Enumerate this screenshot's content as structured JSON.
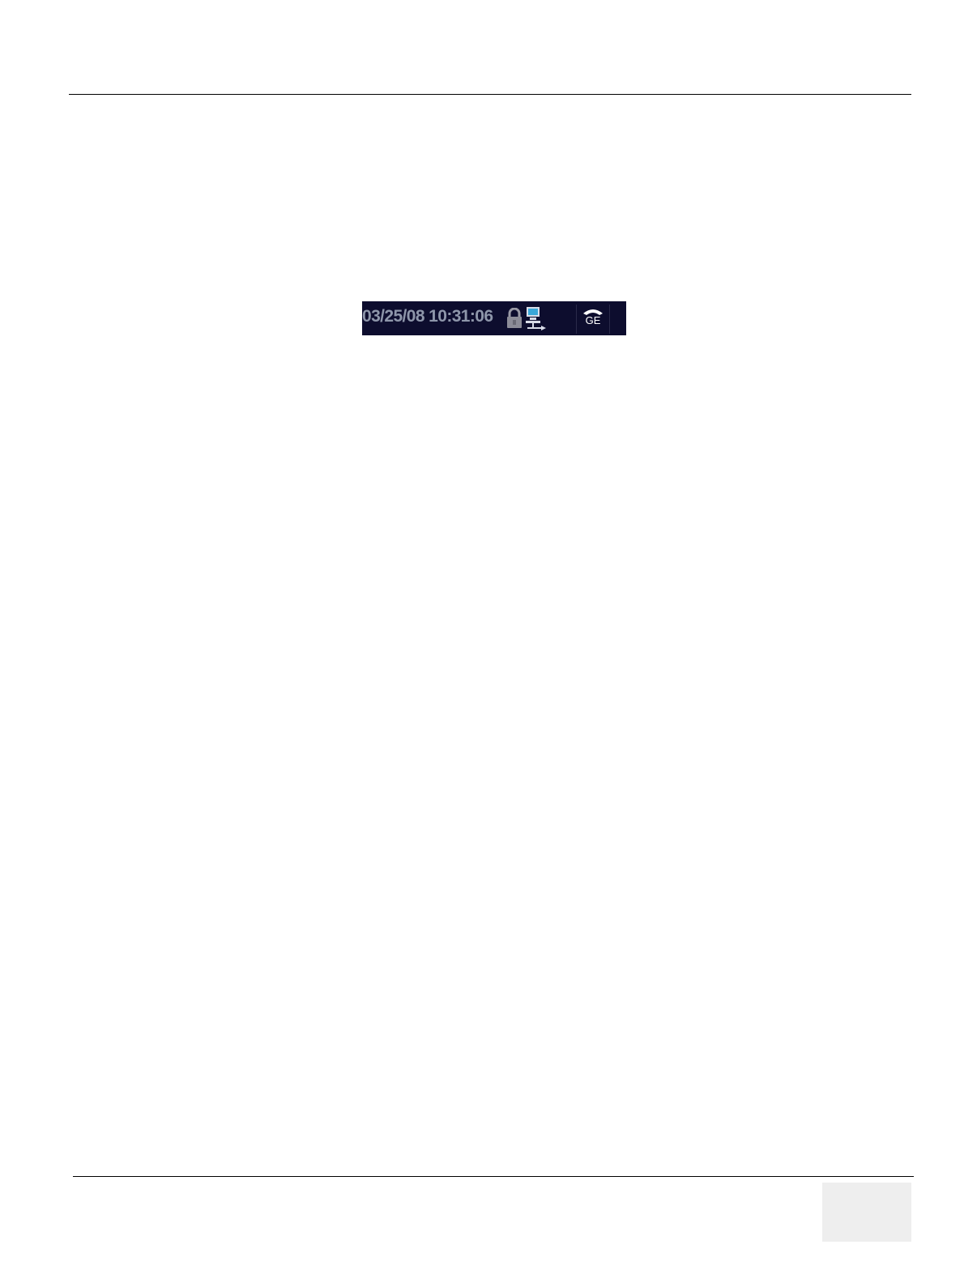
{
  "status_bar": {
    "datetime": "03/25/08 10:31:06",
    "icons": {
      "lock": "lock-icon",
      "network": "network-icon",
      "service": "service-phone-icon"
    },
    "service_label": "GE"
  },
  "colors": {
    "status_bar_background": "#0d0d2e",
    "datetime_text": "#8e96aa",
    "page_number_box": "#eeeeee"
  }
}
